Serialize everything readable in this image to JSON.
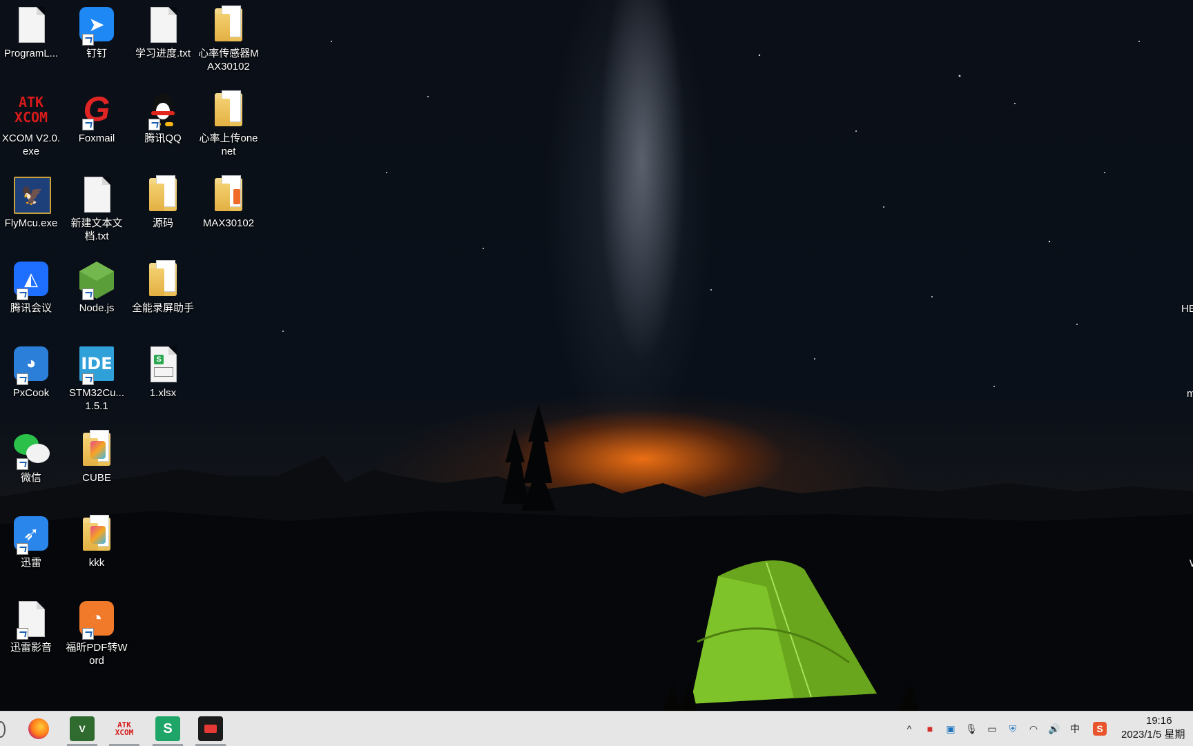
{
  "desktop": {
    "icons": [
      {
        "label": "ProgramL...",
        "icon": "text-document-icon"
      },
      {
        "label": "钉钉",
        "icon": "dingtalk-icon"
      },
      {
        "label": "学习进度.txt",
        "icon": "text-document-icon"
      },
      {
        "label": "心率传感器MAX30102",
        "icon": "folder-icon"
      },
      {
        "label": "XCOM V2.0.exe",
        "icon": "atk-xcom-icon"
      },
      {
        "label": "Foxmail",
        "icon": "foxmail-icon"
      },
      {
        "label": "腾讯QQ",
        "icon": "qq-penguin-icon"
      },
      {
        "label": "心率上传onenet",
        "icon": "folder-icon"
      },
      {
        "label": "FlyMcu.exe",
        "icon": "flymcu-eagle-icon"
      },
      {
        "label": "新建文本文档.txt",
        "icon": "text-document-icon"
      },
      {
        "label": "源码",
        "icon": "folder-icon"
      },
      {
        "label": "MAX30102",
        "icon": "folder-icon"
      },
      {
        "label": "腾讯会议",
        "icon": "tencent-meeting-icon"
      },
      {
        "label": "Node.js",
        "icon": "nodejs-icon"
      },
      {
        "label": "全能录屏助手",
        "icon": "folder-icon"
      },
      {
        "label": "PxCook",
        "icon": "pxcook-icon"
      },
      {
        "label": "STM32Cu... 1.5.1",
        "icon": "stm32cubeide-icon"
      },
      {
        "label": "1.xlsx",
        "icon": "spreadsheet-icon"
      },
      {
        "label": "微信",
        "icon": "wechat-icon"
      },
      {
        "label": "CUBE",
        "icon": "color-folder-icon"
      },
      {
        "label": "迅雷",
        "icon": "xunlei-bird-icon"
      },
      {
        "label": "kkk",
        "icon": "color-folder-icon"
      },
      {
        "label": "迅雷影音",
        "icon": "text-document-icon"
      },
      {
        "label": "福昕PDF转Word",
        "icon": "foxit-pdf-icon"
      }
    ],
    "edge_labels": [
      "HE",
      "m",
      "W"
    ]
  },
  "taskbar": {
    "apps": [
      {
        "name": "firefox",
        "icon": "firefox-icon"
      },
      {
        "name": "vivado",
        "icon": "vivado-icon",
        "text": "V"
      },
      {
        "name": "xcom",
        "icon": "atk-xcom-icon",
        "text": "ATK XCOM"
      },
      {
        "name": "wps-spreadsheet",
        "icon": "wps-spreadsheet-icon",
        "text": "S"
      },
      {
        "name": "screen-recorder",
        "icon": "screen-recorder-icon"
      }
    ],
    "tray": [
      {
        "icon": "chevron-up-icon",
        "glyph": "^"
      },
      {
        "icon": "recorder-tray-icon",
        "glyph": "■"
      },
      {
        "icon": "network-manager-icon",
        "glyph": "▣"
      },
      {
        "icon": "microphone-icon",
        "glyph": "🎙"
      },
      {
        "icon": "battery-icon",
        "glyph": "▭"
      },
      {
        "icon": "security-shield-icon",
        "glyph": "⛨"
      },
      {
        "icon": "wifi-icon",
        "glyph": "◠"
      },
      {
        "icon": "volume-icon",
        "glyph": "🔊"
      },
      {
        "icon": "ime-chinese-icon",
        "glyph": "中"
      },
      {
        "icon": "sogou-ime-icon",
        "glyph": "S"
      }
    ],
    "clock": {
      "time": "19:16",
      "date": "2023/1/5 星期"
    }
  }
}
